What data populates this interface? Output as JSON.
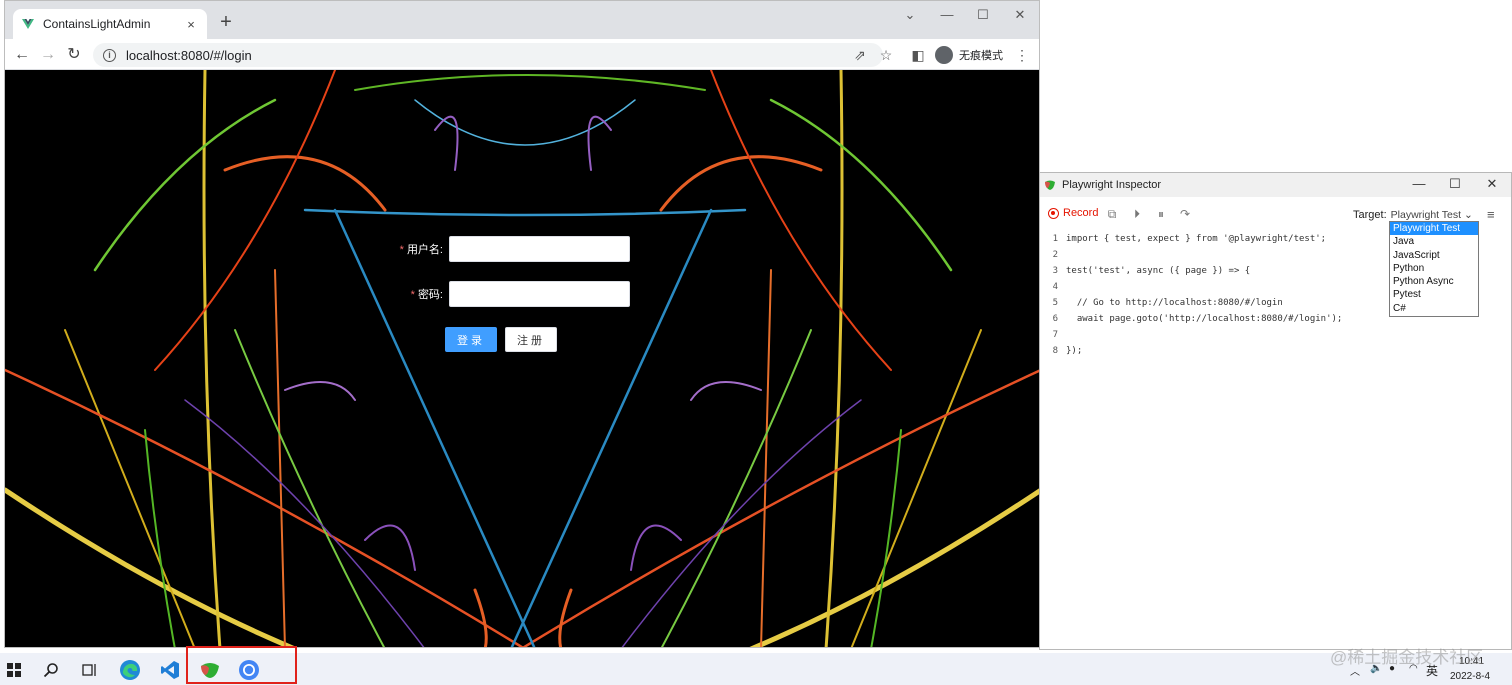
{
  "browser": {
    "tab_title": "ContainsLightAdmin",
    "tab_close": "×",
    "new_tab": "+",
    "url": "localhost:8080/#/login",
    "incognito_label": "无痕模式"
  },
  "login_form": {
    "username_label": "用户名:",
    "password_label": "密码:",
    "required_mark": "*",
    "username_value": "",
    "password_value": "",
    "login_button": "登录",
    "register_button": "注册"
  },
  "inspector": {
    "title": "Playwright Inspector",
    "record_label": "Record",
    "target_label": "Target:",
    "target_value": "Playwright Test ⌄",
    "code_lines": [
      {
        "n": "1",
        "text": "import { test, expect } from '@playwright/test';"
      },
      {
        "n": "2",
        "text": ""
      },
      {
        "n": "3",
        "text": "test('test', async ({ page }) => {"
      },
      {
        "n": "4",
        "text": ""
      },
      {
        "n": "5",
        "text": "  // Go to http://localhost:8080/#/login"
      },
      {
        "n": "6",
        "text": "  await page.goto('http://localhost:8080/#/login');"
      },
      {
        "n": "7",
        "text": ""
      },
      {
        "n": "8",
        "text": "});"
      }
    ],
    "target_options": [
      "Playwright Test",
      "Java",
      "JavaScript",
      "Python",
      "Python Async",
      "Pytest",
      "C#"
    ],
    "selected_option": "Playwright Test"
  },
  "taskbar": {
    "time": "10:41",
    "date": "2022-8-4",
    "ime": "英"
  },
  "watermark": "@稀土掘金技术社区",
  "colors": {
    "primary": "#409eff",
    "required": "#f56c6c",
    "record": "#e51400",
    "highlight": "#e0221b"
  }
}
